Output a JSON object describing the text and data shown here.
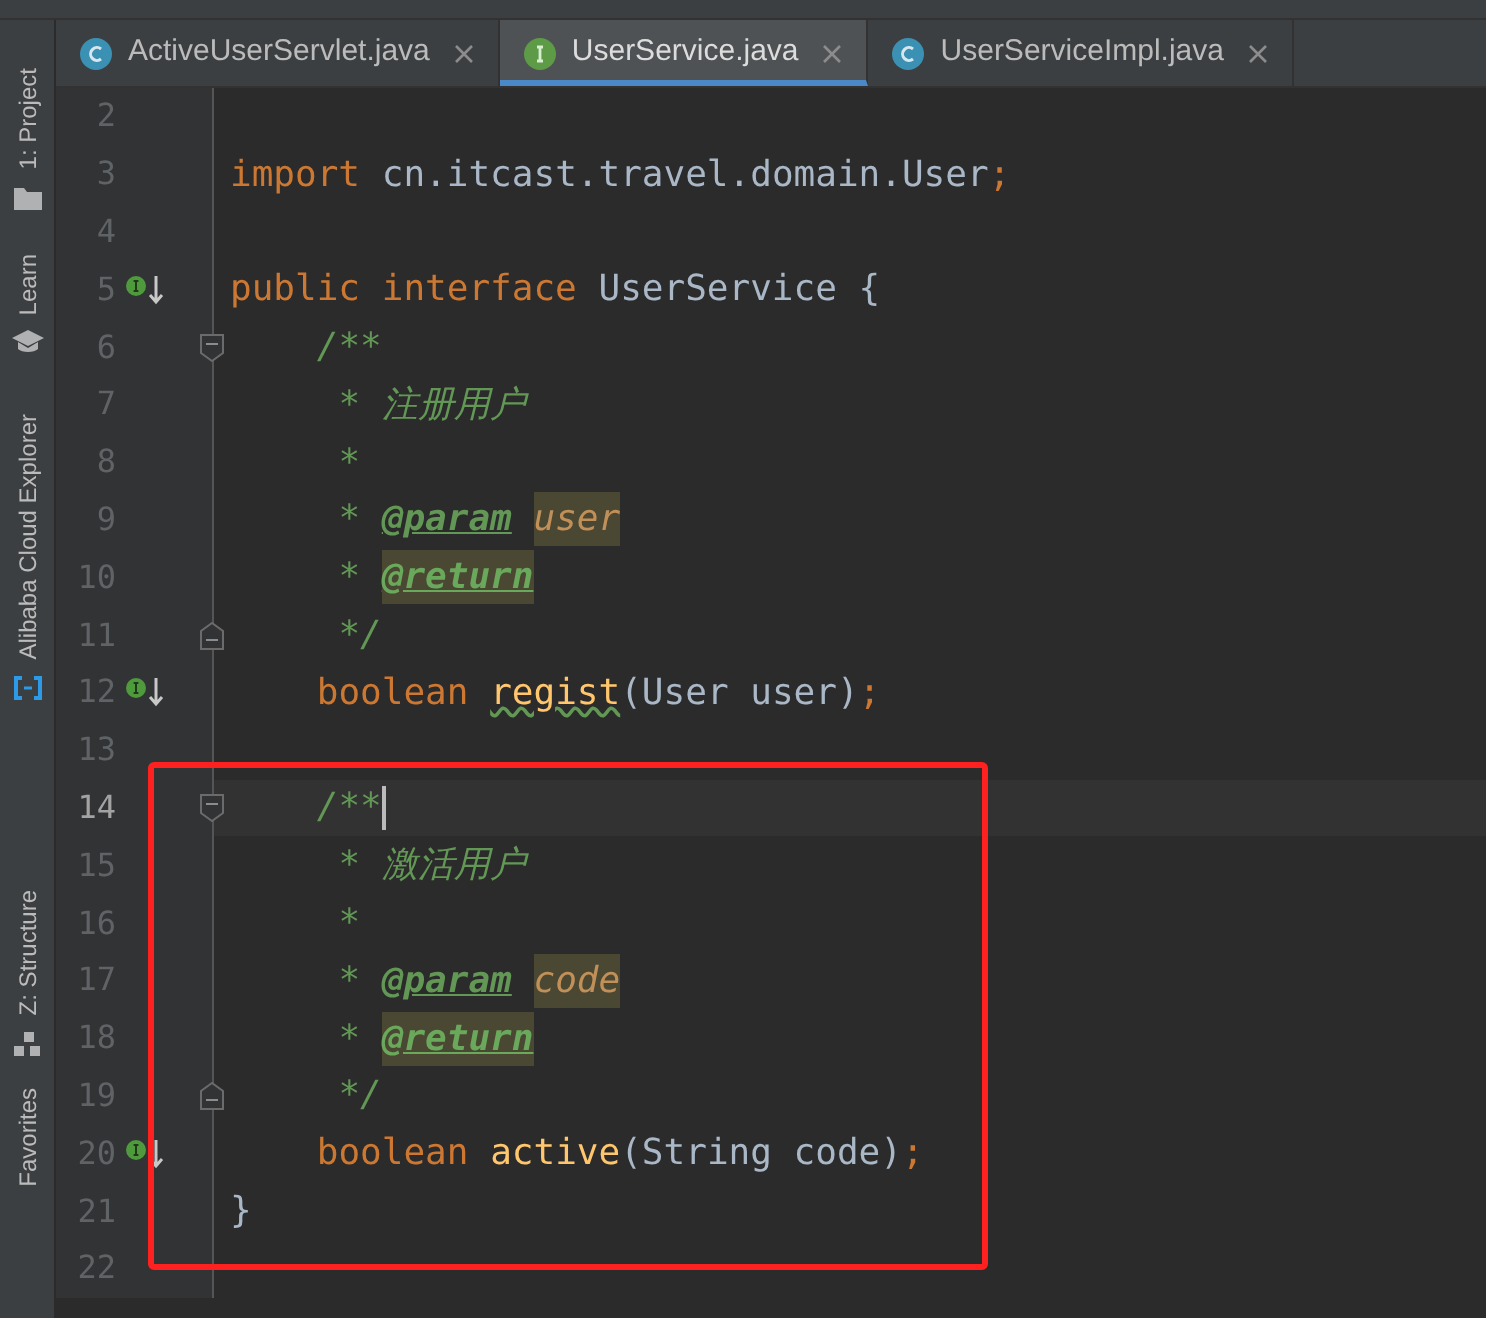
{
  "annotations": [
    {
      "kind": "red_frame"
    }
  ],
  "tool_strip": [
    {
      "label": "1: Project"
    },
    {
      "label": "Learn"
    },
    {
      "label": "Alibaba Cloud Explorer"
    },
    {
      "label": "Z: Structure"
    },
    {
      "label": "Favorites"
    }
  ],
  "tabs": [
    {
      "label": "ActiveUserServlet.java",
      "kind": "class",
      "selected": false
    },
    {
      "label": "UserService.java",
      "kind": "interface",
      "selected": true
    },
    {
      "label": "UserServiceImpl.java",
      "kind": "class",
      "selected": false
    }
  ],
  "lines": [
    {
      "number": "2",
      "implemented": false,
      "fold_start": false,
      "fold_end": false,
      "current": false
    },
    {
      "number": "3",
      "implemented": false,
      "fold_start": false,
      "fold_end": false,
      "current": false,
      "tokens": [
        {
          "text": "import",
          "kind": "keyword"
        },
        {
          "text": " cn.itcast.travel.domain.User",
          "kind": "plain"
        },
        {
          "text": ";",
          "kind": "keyword"
        }
      ]
    },
    {
      "number": "4",
      "implemented": false,
      "fold_start": false,
      "fold_end": false,
      "current": false
    },
    {
      "number": "5",
      "implemented": true,
      "fold_start": false,
      "fold_end": false,
      "current": false,
      "tokens": [
        {
          "text": "public interface",
          "kind": "keyword"
        },
        {
          "text": " UserService {",
          "kind": "plain"
        }
      ]
    },
    {
      "number": "6",
      "implemented": false,
      "fold_start": true,
      "fold_end": false,
      "current": false,
      "tokens": [
        {
          "text": "    /**",
          "kind": "comment"
        }
      ]
    },
    {
      "number": "7",
      "implemented": false,
      "fold_start": false,
      "fold_end": false,
      "current": false,
      "tokens": [
        {
          "text": "     * 注册用户",
          "kind": "comment"
        }
      ]
    },
    {
      "number": "8",
      "implemented": false,
      "fold_start": false,
      "fold_end": false,
      "current": false,
      "tokens": [
        {
          "text": "     *",
          "kind": "comment"
        }
      ]
    },
    {
      "number": "9",
      "implemented": false,
      "fold_start": false,
      "fold_end": false,
      "current": false,
      "tokens": [
        {
          "text": "     *",
          "kind": "comment"
        },
        {
          "text": " @param",
          "kind": "doc_tag"
        },
        {
          "text": " user",
          "kind": "param_warning"
        }
      ]
    },
    {
      "number": "10",
      "implemented": false,
      "fold_start": false,
      "fold_end": false,
      "current": false,
      "tokens": [
        {
          "text": "     *",
          "kind": "comment"
        },
        {
          "text": " @return",
          "kind": "doc_tag_warning"
        }
      ]
    },
    {
      "number": "11",
      "implemented": false,
      "fold_start": false,
      "fold_end": true,
      "current": false,
      "tokens": [
        {
          "text": "     */",
          "kind": "comment"
        }
      ]
    },
    {
      "number": "12",
      "implemented": true,
      "fold_start": false,
      "fold_end": false,
      "current": false,
      "tokens": [
        {
          "text": "    boolean",
          "kind": "keyword"
        },
        {
          "text": " regist",
          "kind": "method_typo"
        },
        {
          "text": "(User user)",
          "kind": "plain"
        },
        {
          "text": ";",
          "kind": "keyword"
        }
      ]
    },
    {
      "number": "13",
      "implemented": false,
      "fold_start": false,
      "fold_end": false,
      "current": false
    },
    {
      "number": "14",
      "implemented": false,
      "fold_start": true,
      "fold_end": false,
      "current": true,
      "tokens": [
        {
          "text": "    /**",
          "kind": "comment"
        }
      ]
    },
    {
      "number": "15",
      "implemented": false,
      "fold_start": false,
      "fold_end": false,
      "current": false,
      "tokens": [
        {
          "text": "     * 激活用户",
          "kind": "comment"
        }
      ]
    },
    {
      "number": "16",
      "implemented": false,
      "fold_start": false,
      "fold_end": false,
      "current": false,
      "tokens": [
        {
          "text": "     *",
          "kind": "comment"
        }
      ]
    },
    {
      "number": "17",
      "implemented": false,
      "fold_start": false,
      "fold_end": false,
      "current": false,
      "tokens": [
        {
          "text": "     *",
          "kind": "comment"
        },
        {
          "text": " @param",
          "kind": "doc_tag"
        },
        {
          "text": " code",
          "kind": "param_warning"
        }
      ]
    },
    {
      "number": "18",
      "implemented": false,
      "fold_start": false,
      "fold_end": false,
      "current": false,
      "tokens": [
        {
          "text": "     *",
          "kind": "comment"
        },
        {
          "text": " @return",
          "kind": "doc_tag_warning"
        }
      ]
    },
    {
      "number": "19",
      "implemented": false,
      "fold_start": false,
      "fold_end": true,
      "current": false,
      "tokens": [
        {
          "text": "     */",
          "kind": "comment"
        }
      ]
    },
    {
      "number": "20",
      "implemented": true,
      "fold_start": false,
      "fold_end": false,
      "current": false,
      "tokens": [
        {
          "text": "    boolean",
          "kind": "keyword"
        },
        {
          "text": " active",
          "kind": "method"
        },
        {
          "text": "(String code)",
          "kind": "plain"
        },
        {
          "text": ";",
          "kind": "keyword"
        }
      ]
    },
    {
      "number": "21",
      "implemented": false,
      "fold_start": false,
      "fold_end": false,
      "current": false,
      "tokens": [
        {
          "text": "}",
          "kind": "plain"
        }
      ]
    },
    {
      "number": "22",
      "implemented": false,
      "fold_start": false,
      "fold_end": false,
      "current": false
    }
  ]
}
